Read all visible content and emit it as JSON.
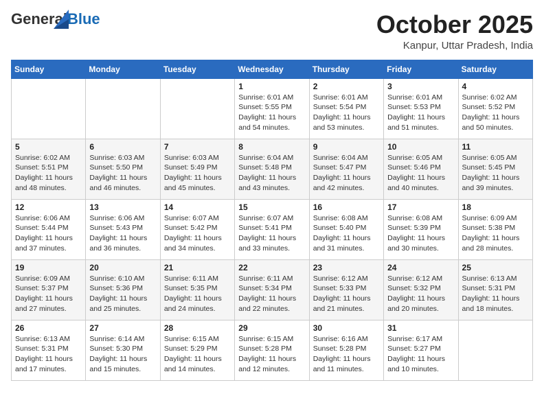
{
  "logo": {
    "general": "General",
    "blue": "Blue"
  },
  "header": {
    "month": "October 2025",
    "location": "Kanpur, Uttar Pradesh, India"
  },
  "weekdays": [
    "Sunday",
    "Monday",
    "Tuesday",
    "Wednesday",
    "Thursday",
    "Friday",
    "Saturday"
  ],
  "weeks": [
    [
      {
        "day": "",
        "sunrise": "",
        "sunset": "",
        "daylight": ""
      },
      {
        "day": "",
        "sunrise": "",
        "sunset": "",
        "daylight": ""
      },
      {
        "day": "",
        "sunrise": "",
        "sunset": "",
        "daylight": ""
      },
      {
        "day": "1",
        "sunrise": "Sunrise: 6:01 AM",
        "sunset": "Sunset: 5:55 PM",
        "daylight": "Daylight: 11 hours and 54 minutes."
      },
      {
        "day": "2",
        "sunrise": "Sunrise: 6:01 AM",
        "sunset": "Sunset: 5:54 PM",
        "daylight": "Daylight: 11 hours and 53 minutes."
      },
      {
        "day": "3",
        "sunrise": "Sunrise: 6:01 AM",
        "sunset": "Sunset: 5:53 PM",
        "daylight": "Daylight: 11 hours and 51 minutes."
      },
      {
        "day": "4",
        "sunrise": "Sunrise: 6:02 AM",
        "sunset": "Sunset: 5:52 PM",
        "daylight": "Daylight: 11 hours and 50 minutes."
      }
    ],
    [
      {
        "day": "5",
        "sunrise": "Sunrise: 6:02 AM",
        "sunset": "Sunset: 5:51 PM",
        "daylight": "Daylight: 11 hours and 48 minutes."
      },
      {
        "day": "6",
        "sunrise": "Sunrise: 6:03 AM",
        "sunset": "Sunset: 5:50 PM",
        "daylight": "Daylight: 11 hours and 46 minutes."
      },
      {
        "day": "7",
        "sunrise": "Sunrise: 6:03 AM",
        "sunset": "Sunset: 5:49 PM",
        "daylight": "Daylight: 11 hours and 45 minutes."
      },
      {
        "day": "8",
        "sunrise": "Sunrise: 6:04 AM",
        "sunset": "Sunset: 5:48 PM",
        "daylight": "Daylight: 11 hours and 43 minutes."
      },
      {
        "day": "9",
        "sunrise": "Sunrise: 6:04 AM",
        "sunset": "Sunset: 5:47 PM",
        "daylight": "Daylight: 11 hours and 42 minutes."
      },
      {
        "day": "10",
        "sunrise": "Sunrise: 6:05 AM",
        "sunset": "Sunset: 5:46 PM",
        "daylight": "Daylight: 11 hours and 40 minutes."
      },
      {
        "day": "11",
        "sunrise": "Sunrise: 6:05 AM",
        "sunset": "Sunset: 5:45 PM",
        "daylight": "Daylight: 11 hours and 39 minutes."
      }
    ],
    [
      {
        "day": "12",
        "sunrise": "Sunrise: 6:06 AM",
        "sunset": "Sunset: 5:44 PM",
        "daylight": "Daylight: 11 hours and 37 minutes."
      },
      {
        "day": "13",
        "sunrise": "Sunrise: 6:06 AM",
        "sunset": "Sunset: 5:43 PM",
        "daylight": "Daylight: 11 hours and 36 minutes."
      },
      {
        "day": "14",
        "sunrise": "Sunrise: 6:07 AM",
        "sunset": "Sunset: 5:42 PM",
        "daylight": "Daylight: 11 hours and 34 minutes."
      },
      {
        "day": "15",
        "sunrise": "Sunrise: 6:07 AM",
        "sunset": "Sunset: 5:41 PM",
        "daylight": "Daylight: 11 hours and 33 minutes."
      },
      {
        "day": "16",
        "sunrise": "Sunrise: 6:08 AM",
        "sunset": "Sunset: 5:40 PM",
        "daylight": "Daylight: 11 hours and 31 minutes."
      },
      {
        "day": "17",
        "sunrise": "Sunrise: 6:08 AM",
        "sunset": "Sunset: 5:39 PM",
        "daylight": "Daylight: 11 hours and 30 minutes."
      },
      {
        "day": "18",
        "sunrise": "Sunrise: 6:09 AM",
        "sunset": "Sunset: 5:38 PM",
        "daylight": "Daylight: 11 hours and 28 minutes."
      }
    ],
    [
      {
        "day": "19",
        "sunrise": "Sunrise: 6:09 AM",
        "sunset": "Sunset: 5:37 PM",
        "daylight": "Daylight: 11 hours and 27 minutes."
      },
      {
        "day": "20",
        "sunrise": "Sunrise: 6:10 AM",
        "sunset": "Sunset: 5:36 PM",
        "daylight": "Daylight: 11 hours and 25 minutes."
      },
      {
        "day": "21",
        "sunrise": "Sunrise: 6:11 AM",
        "sunset": "Sunset: 5:35 PM",
        "daylight": "Daylight: 11 hours and 24 minutes."
      },
      {
        "day": "22",
        "sunrise": "Sunrise: 6:11 AM",
        "sunset": "Sunset: 5:34 PM",
        "daylight": "Daylight: 11 hours and 22 minutes."
      },
      {
        "day": "23",
        "sunrise": "Sunrise: 6:12 AM",
        "sunset": "Sunset: 5:33 PM",
        "daylight": "Daylight: 11 hours and 21 minutes."
      },
      {
        "day": "24",
        "sunrise": "Sunrise: 6:12 AM",
        "sunset": "Sunset: 5:32 PM",
        "daylight": "Daylight: 11 hours and 20 minutes."
      },
      {
        "day": "25",
        "sunrise": "Sunrise: 6:13 AM",
        "sunset": "Sunset: 5:31 PM",
        "daylight": "Daylight: 11 hours and 18 minutes."
      }
    ],
    [
      {
        "day": "26",
        "sunrise": "Sunrise: 6:13 AM",
        "sunset": "Sunset: 5:31 PM",
        "daylight": "Daylight: 11 hours and 17 minutes."
      },
      {
        "day": "27",
        "sunrise": "Sunrise: 6:14 AM",
        "sunset": "Sunset: 5:30 PM",
        "daylight": "Daylight: 11 hours and 15 minutes."
      },
      {
        "day": "28",
        "sunrise": "Sunrise: 6:15 AM",
        "sunset": "Sunset: 5:29 PM",
        "daylight": "Daylight: 11 hours and 14 minutes."
      },
      {
        "day": "29",
        "sunrise": "Sunrise: 6:15 AM",
        "sunset": "Sunset: 5:28 PM",
        "daylight": "Daylight: 11 hours and 12 minutes."
      },
      {
        "day": "30",
        "sunrise": "Sunrise: 6:16 AM",
        "sunset": "Sunset: 5:28 PM",
        "daylight": "Daylight: 11 hours and 11 minutes."
      },
      {
        "day": "31",
        "sunrise": "Sunrise: 6:17 AM",
        "sunset": "Sunset: 5:27 PM",
        "daylight": "Daylight: 11 hours and 10 minutes."
      },
      {
        "day": "",
        "sunrise": "",
        "sunset": "",
        "daylight": ""
      }
    ]
  ]
}
